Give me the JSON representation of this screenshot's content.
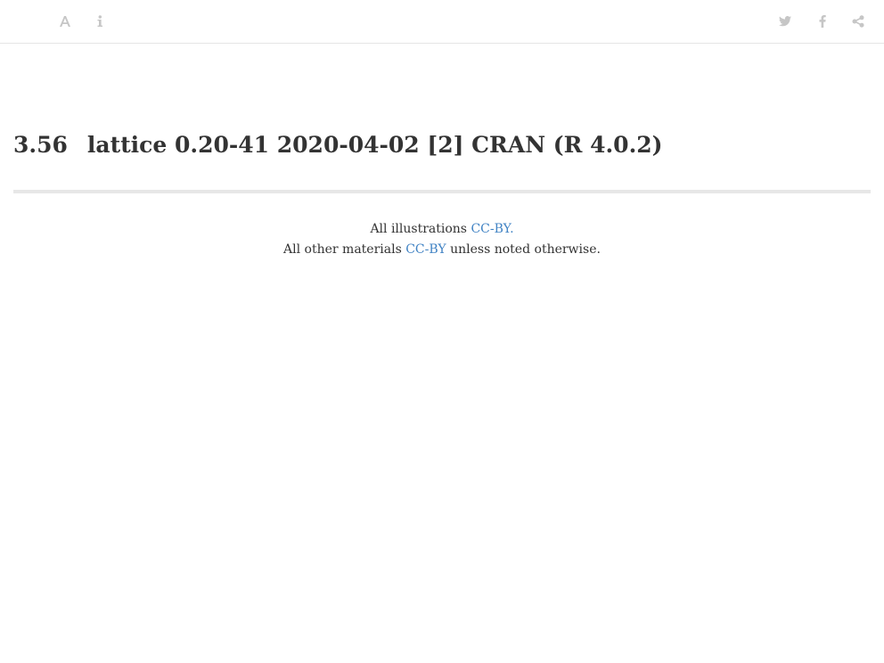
{
  "toolbar": {
    "left_icons": [
      "font-settings-icon",
      "info-icon"
    ],
    "right_icons": [
      "twitter-icon",
      "facebook-icon",
      "share-icon"
    ],
    "icon_color": "#c6c6c6"
  },
  "section": {
    "number": "3.56",
    "title": "lattice 0.20-41 2020-04-02 [2] CRAN (R 4.0.2)"
  },
  "footer": {
    "line1_text": "All illustrations",
    "line1_link": "CC-BY.",
    "line2_text": "All other materials",
    "line2_link": "CC-BY",
    "line2_suffix": "unless noted otherwise.",
    "link_color": "#4183c4"
  }
}
